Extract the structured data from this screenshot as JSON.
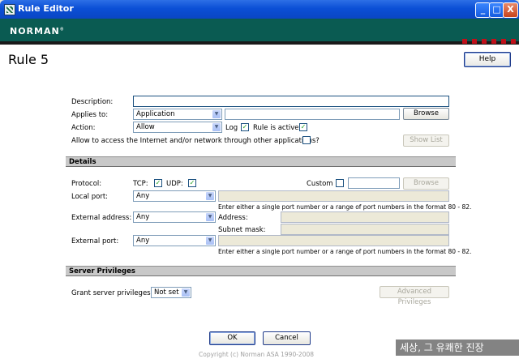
{
  "window": {
    "title": "Rule Editor",
    "minimize": "_",
    "maximize": "□",
    "close": "X"
  },
  "brand": {
    "name": "NORMAN",
    "mark": "®"
  },
  "rule_title": "Rule 5",
  "help_label": "Help",
  "general": {
    "description_label": "Description:",
    "description_value": "",
    "applies_to_label": "Applies to:",
    "applies_to_value": "Application",
    "applies_to_path": "",
    "browse_label": "Browse",
    "action_label": "Action:",
    "action_value": "Allow",
    "log_label": "Log",
    "rule_active_label": "Rule is active",
    "allow_other_label": "Allow to access the Internet and/or network through other applications?",
    "show_list_label": "Show List"
  },
  "details": {
    "header": "Details",
    "protocol_label": "Protocol:",
    "tcp_label": "TCP:",
    "udp_label": "UDP:",
    "custom_label": "Custom",
    "custom_value": "",
    "browse_label": "Browse",
    "local_port_label": "Local port:",
    "local_port_value": "Any",
    "port_hint": "Enter either a single port number or a range of port numbers in the format 80 - 82.",
    "external_address_label": "External address:",
    "external_address_value": "Any",
    "address_label": "Address:",
    "subnet_mask_label": "Subnet mask:",
    "external_port_label": "External port:",
    "external_port_value": "Any",
    "port_hint_2": "Enter either a single port number or a range of port numbers in the format 80 - 82."
  },
  "server": {
    "header": "Server Privileges",
    "grant_label": "Grant server privileges?",
    "grant_value": "Not set",
    "advanced_label": "Advanced Privileges"
  },
  "buttons": {
    "ok": "OK",
    "cancel": "Cancel"
  },
  "copyright": "Copyright (c) Norman ASA 1990-2008",
  "watermark": "세상, 그 유쾌한 진장",
  "colors": {
    "banner": "#0a5b52",
    "accent_red": "#c0101a",
    "titlebar": "#0b4fd6"
  }
}
